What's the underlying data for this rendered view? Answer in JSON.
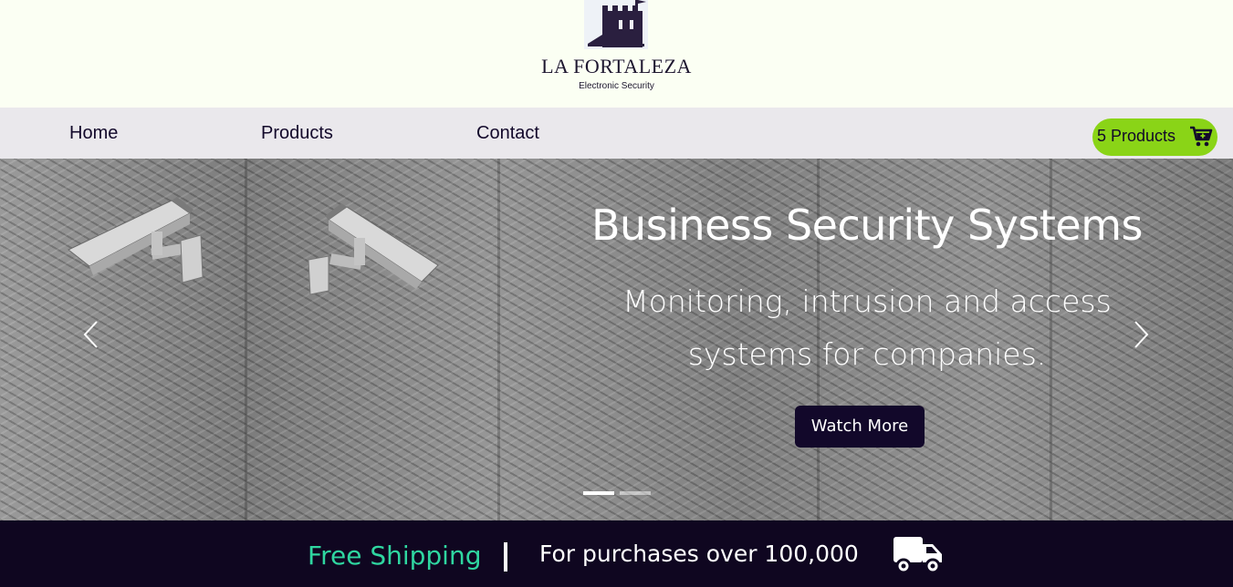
{
  "brand": {
    "name": "LA FORTALEZA",
    "tagline": "Electronic Security",
    "logo_icon": "castle-tower-icon",
    "logo_color": "#2a1f3f"
  },
  "nav": {
    "items": [
      {
        "label": "Home"
      },
      {
        "label": "Products"
      },
      {
        "label": "Contact"
      }
    ],
    "cart": {
      "label": "5 Products",
      "icon": "cart-plus-icon",
      "color": "#8ad417"
    }
  },
  "hero": {
    "title": "Business Security Systems",
    "subtitle": "Monitoring, intrusion and access systems for companies.",
    "cta_label": "Watch More",
    "prev_icon": "chevron-left-icon",
    "next_icon": "chevron-right-icon",
    "slide_count": 2,
    "active_slide": 1,
    "image": "security-cameras-on-metal-mesh-wall"
  },
  "shipping": {
    "highlight": "Free Shipping",
    "text": "For purchases over 100,000",
    "icon": "delivery-truck-icon",
    "highlight_color": "#2fd6a0",
    "background": "#0f0620"
  }
}
